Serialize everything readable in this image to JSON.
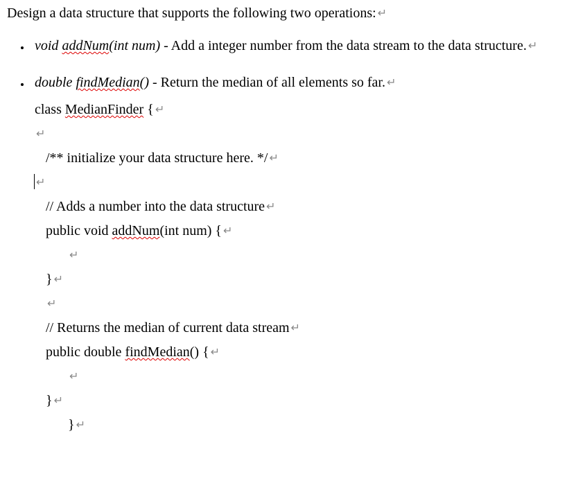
{
  "intro": "Design a data structure that supports the following two operations:",
  "bullets": [
    {
      "sig": "void ",
      "fn": "addNum",
      "args": "(int num)",
      "desc": " - Add a integer number from the data stream to the data structure."
    },
    {
      "sig": "double ",
      "fn": "findMedian",
      "args": "()",
      "desc": " - Return the median of all elements so far."
    }
  ],
  "code": {
    "class_kw": "class ",
    "class_name": "MedianFinder",
    "class_open": " {",
    "init_comment": "/** initialize your data structure here. */",
    "add_comment": "// Adds a number into the data structure",
    "add_prefix": "public void ",
    "add_name": "addNum",
    "add_suffix": "(int num) {",
    "close_brace": "}",
    "ret_comment": "// Returns the median of current data stream",
    "ret_prefix": "public double ",
    "ret_name": "findMedian",
    "ret_suffix": "() {",
    "close_brace2": "}",
    "close_brace3": "}"
  },
  "arrow": "↵"
}
